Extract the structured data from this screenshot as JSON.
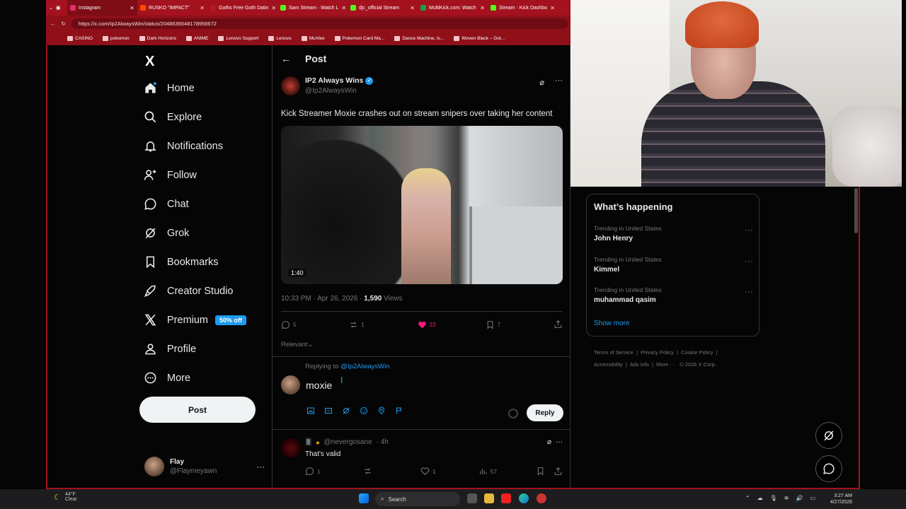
{
  "browser": {
    "tabs": [
      {
        "label": "Instagram",
        "color": "#e1306c"
      },
      {
        "label": "RUSKO \"IMPACT\"",
        "color": "#ff4d00"
      },
      {
        "label": "Goths Free Goth Datin",
        "color": "#b01a25"
      },
      {
        "label": "Sam Stream · Watch L",
        "color": "#53fc18"
      },
      {
        "label": "djc_official Stream",
        "color": "#53fc18"
      },
      {
        "label": "MultiKick.com: Watch",
        "color": "#16a34a"
      },
      {
        "label": "Stream · Kick Dashbo",
        "color": "#53fc18"
      }
    ],
    "url": "https://x.com/Ip2AlwaysWin/status/2048636548178956672",
    "bookmarks": [
      "CASINO",
      "pokemon",
      "Dark Horizons",
      "ANIME",
      "Lenovo Support",
      "Lenovo",
      "McAfee",
      "Pokemon Card Ma...",
      "Dance Machine, ls...",
      "Woven Black – Got..."
    ]
  },
  "nav": {
    "logo": "X",
    "items": [
      {
        "label": "Home",
        "icon": "home-icon"
      },
      {
        "label": "Explore",
        "icon": "search-icon"
      },
      {
        "label": "Notifications",
        "icon": "bell-icon"
      },
      {
        "label": "Follow",
        "icon": "add-person-icon"
      },
      {
        "label": "Chat",
        "icon": "chat-icon"
      },
      {
        "label": "Grok",
        "icon": "grok-icon"
      },
      {
        "label": "Bookmarks",
        "icon": "bookmark-icon"
      },
      {
        "label": "Creator Studio",
        "icon": "rocket-icon"
      },
      {
        "label": "Premium",
        "icon": "x-icon",
        "badge": "50% off"
      },
      {
        "label": "Profile",
        "icon": "person-icon"
      },
      {
        "label": "More",
        "icon": "more-circle-icon"
      }
    ],
    "post_label": "Post",
    "account": {
      "name": "Flay",
      "handle": "@Flaymeyawn"
    }
  },
  "main": {
    "header_title": "Post",
    "tweet": {
      "name": "IP2 Always Wins",
      "handle": "@Ip2AlwaysWin",
      "text": "Kick Streamer Moxie crashes out on stream snipers over taking her content",
      "video_duration": "1:40",
      "timestamp": "10:33 PM · Apr 26, 2026 · ",
      "views_count": "1,590",
      "views_label": " Views",
      "replies": "5",
      "reposts": "1",
      "likes": "23",
      "bookmarks": "7",
      "like_color": "#f91880"
    },
    "sort_label": "Relevant",
    "reply_box": {
      "replying_prefix": "Replying to ",
      "replying_handle": "@Ip2AlwaysWin",
      "draft": "moxie",
      "reply_label": "Reply"
    },
    "reply": {
      "handle": "@nevergosane",
      "age": "· 4h",
      "text": "That's valid",
      "replies": "1",
      "likes": "1",
      "views": "57"
    }
  },
  "sidebar": {
    "trends_title": "What’s happening",
    "trends": [
      {
        "context": "Trending in United States",
        "name": "John Henry"
      },
      {
        "context": "Trending in United States",
        "name": "Kimmel"
      },
      {
        "context": "Trending in United States",
        "name": "muhammad qasim"
      }
    ],
    "show_more": "Show more",
    "footer": [
      "Terms of Service",
      "Privacy Policy",
      "Cookie Policy",
      "Accessibility",
      "Ads info",
      "More ···",
      "© 2026 X Corp."
    ]
  },
  "taskbar": {
    "temp": "44°F",
    "condition": "Clear",
    "search_placeholder": "Search",
    "time": "3:27 AM",
    "date": "4/27/2026"
  }
}
